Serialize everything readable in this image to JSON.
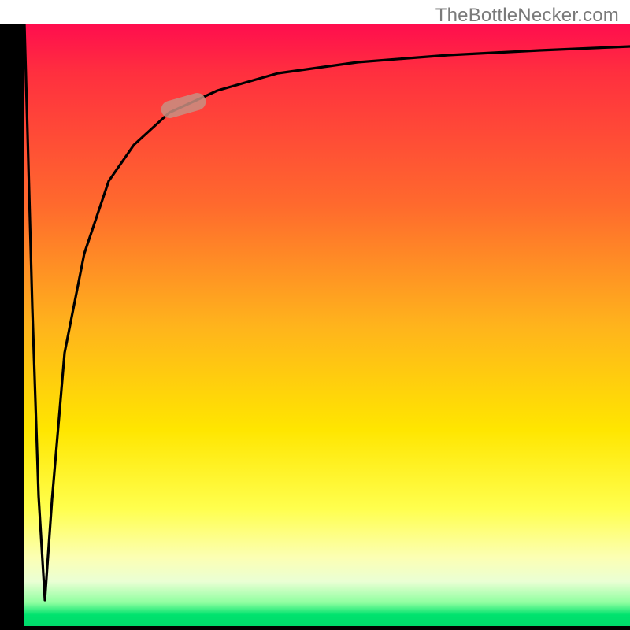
{
  "watermark": "TheBottleNecker.com",
  "colors": {
    "frame_black": "#000000",
    "curve_black": "#000000",
    "marker_fill": "#c88f82",
    "marker_opacity": "0.85",
    "watermark_gray": "#7a7a7a"
  },
  "chart_data": {
    "type": "line",
    "title": "",
    "xlabel": "",
    "ylabel": "",
    "xlim": [
      0,
      100
    ],
    "ylim": [
      0,
      100
    ],
    "note": "No numeric axis ticks or labels are rendered in the image; values below are geometric estimates (0–100 scale on both axes) for the single plotted curve.",
    "series": [
      {
        "name": "bottleneck-curve",
        "x": [
          0.0,
          1.0,
          2.0,
          3.0,
          4.0,
          5.0,
          7.0,
          10.0,
          14.0,
          18.0,
          24.0,
          32.0,
          42.0,
          55.0,
          70.0,
          85.0,
          100.0
        ],
        "y": [
          100.0,
          80.0,
          50.0,
          18.0,
          4.0,
          20.0,
          45.0,
          62.0,
          74.0,
          80.0,
          85.3,
          89.0,
          91.8,
          93.6,
          94.8,
          95.6,
          96.2
        ]
      }
    ],
    "marker": {
      "on_series": "bottleneck-curve",
      "x_range": [
        23.0,
        30.0
      ],
      "y_range": [
        85.0,
        88.5
      ],
      "shape": "rounded-segment"
    }
  }
}
